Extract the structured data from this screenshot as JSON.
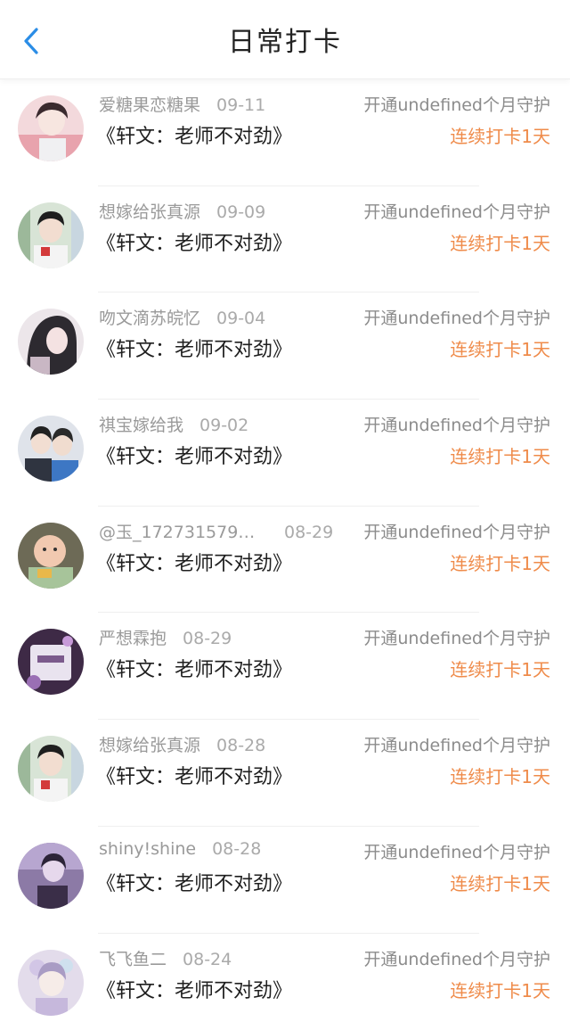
{
  "header": {
    "title": "日常打卡",
    "back_icon": "chevron-left-icon",
    "accent_color": "#2b8de6"
  },
  "colors": {
    "streak": "#ef8b4a",
    "meta": "#9a9a9a",
    "book": "#1f1f1f"
  },
  "entries": [
    {
      "name": "爱糖果恋糖果",
      "date": "09-11",
      "note": "开通undefined个月守护",
      "book": "《轩文：老师不对劲》",
      "streak": "连续打卡1天"
    },
    {
      "name": "想嫁给张真源",
      "date": "09-09",
      "note": "开通undefined个月守护",
      "book": "《轩文：老师不对劲》",
      "streak": "连续打卡1天"
    },
    {
      "name": "吻文滴苏皖忆",
      "date": "09-04",
      "note": "开通undefined个月守护",
      "book": "《轩文：老师不对劲》",
      "streak": "连续打卡1天"
    },
    {
      "name": "祺宝嫁给我",
      "date": "09-02",
      "note": "开通undefined个月守护",
      "book": "《轩文：老师不对劲》",
      "streak": "连续打卡1天"
    },
    {
      "name": "@玉_172731579…",
      "date": "08-29",
      "note": "开通undefined个月守护",
      "book": "《轩文：老师不对劲》",
      "streak": "连续打卡1天"
    },
    {
      "name": "严想霖抱",
      "date": "08-29",
      "note": "开通undefined个月守护",
      "book": "《轩文：老师不对劲》",
      "streak": "连续打卡1天"
    },
    {
      "name": "想嫁给张真源",
      "date": "08-28",
      "note": "开通undefined个月守护",
      "book": "《轩文：老师不对劲》",
      "streak": "连续打卡1天"
    },
    {
      "name": "shiny!shine",
      "date": "08-28",
      "note": "开通undefined个月守护",
      "book": "《轩文：老师不对劲》",
      "streak": "连续打卡1天"
    },
    {
      "name": "飞飞鱼二",
      "date": "08-24",
      "note": "开通undefined个月守护",
      "book": "《轩文：老师不对劲》",
      "streak": "连续打卡1天"
    }
  ]
}
